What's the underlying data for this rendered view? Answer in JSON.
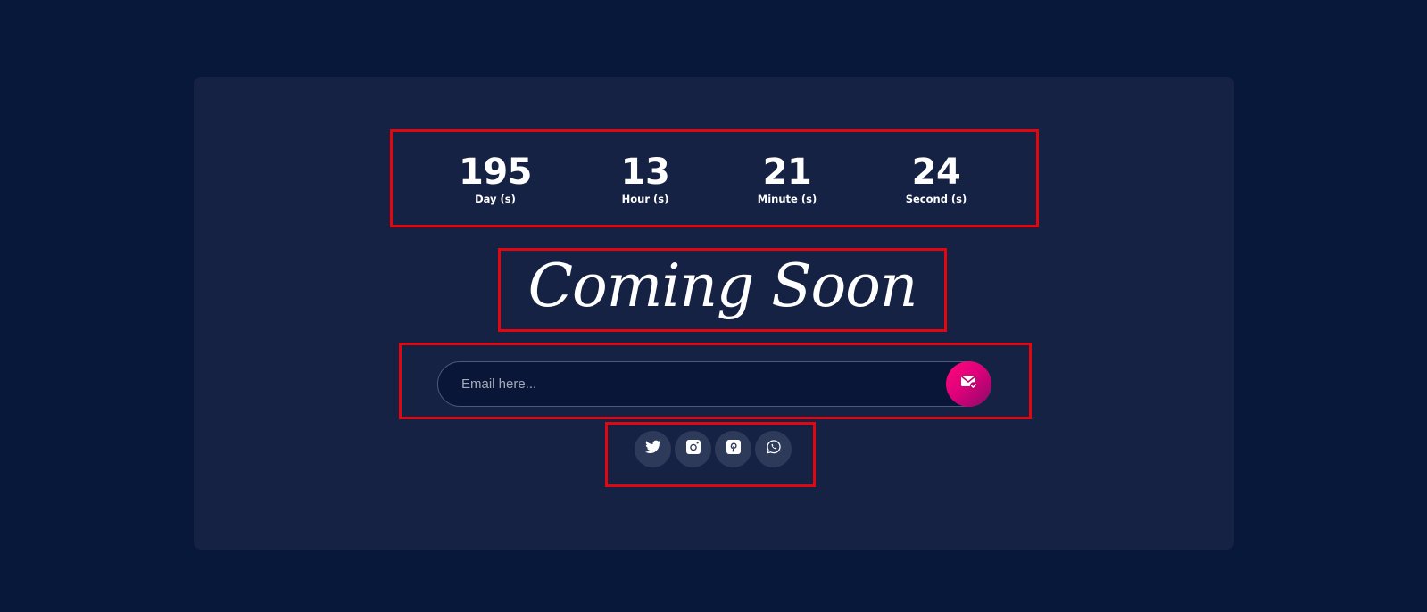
{
  "countdown": {
    "days": {
      "value": "195",
      "label": "Day (s)"
    },
    "hours": {
      "value": "13",
      "label": "Hour (s)"
    },
    "minutes": {
      "value": "21",
      "label": "Minute (s)"
    },
    "seconds": {
      "value": "24",
      "label": "Second (s)"
    }
  },
  "title": "Coming Soon",
  "subscribe": {
    "placeholder": "Email here...",
    "button_icon": "mail-check-icon"
  },
  "social": [
    {
      "name": "twitter",
      "icon": "twitter-icon"
    },
    {
      "name": "instagram",
      "icon": "instagram-icon"
    },
    {
      "name": "pinterest",
      "icon": "pinterest-icon"
    },
    {
      "name": "whatsapp",
      "icon": "whatsapp-icon"
    }
  ],
  "colors": {
    "background": "#08183a",
    "card": "#152243",
    "highlight": "#e1060f",
    "accent": "#ff0a7a",
    "social_bg": "#2d3a5a"
  }
}
